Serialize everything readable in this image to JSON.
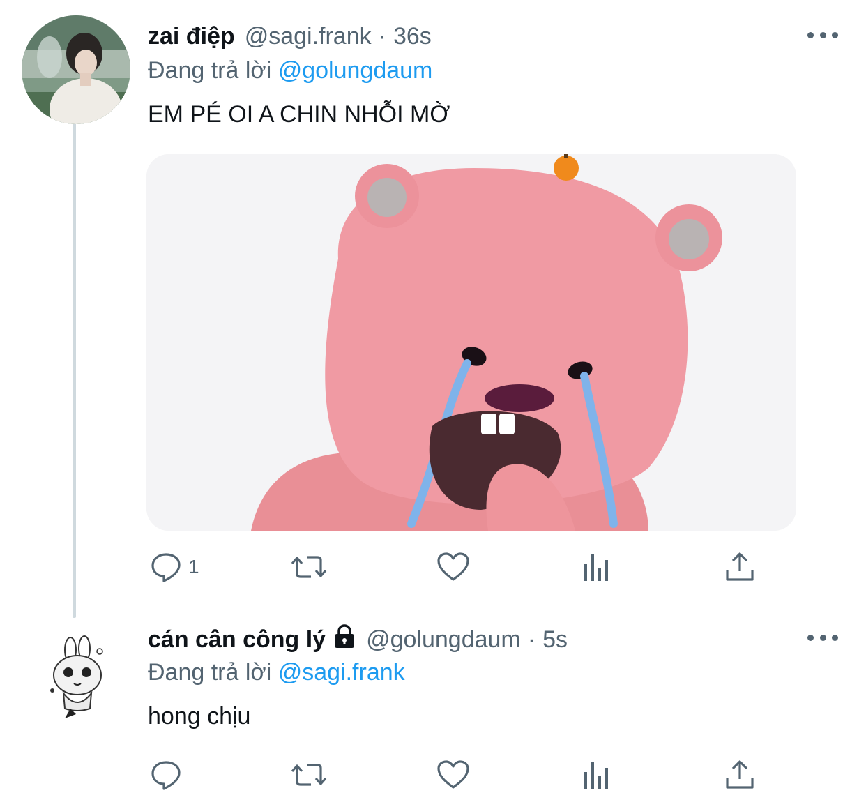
{
  "tweets": [
    {
      "display_name": "zai điệp",
      "handle": "@sagi.frank",
      "time": "36s",
      "reply_prefix": "Đang trả lời",
      "reply_to": "@golungdaum",
      "text": "EM PÉ OI A CHIN NHỖI MỜ",
      "has_media": true,
      "reply_count": "1",
      "avatar_icon": "profile-photo-avatar"
    },
    {
      "display_name": "cán cân công lý",
      "handle": "@golungdaum",
      "time": "5s",
      "reply_prefix": "Đang trả lời",
      "reply_to": "@sagi.frank",
      "text": "hong chịu",
      "has_media": false,
      "reply_count": "",
      "protected": true,
      "avatar_icon": "bunny-sketch-avatar"
    }
  ],
  "icons": {
    "reply": "reply-icon",
    "retweet": "retweet-icon",
    "like": "heart-icon",
    "analytics": "analytics-icon",
    "share": "share-icon",
    "more": "more-icon",
    "lock": "lock-icon"
  },
  "colors": {
    "link": "#1d9bf0",
    "secondary_text": "#536471",
    "thread_line": "#cfd9de",
    "media_character": "#f09aa3"
  }
}
